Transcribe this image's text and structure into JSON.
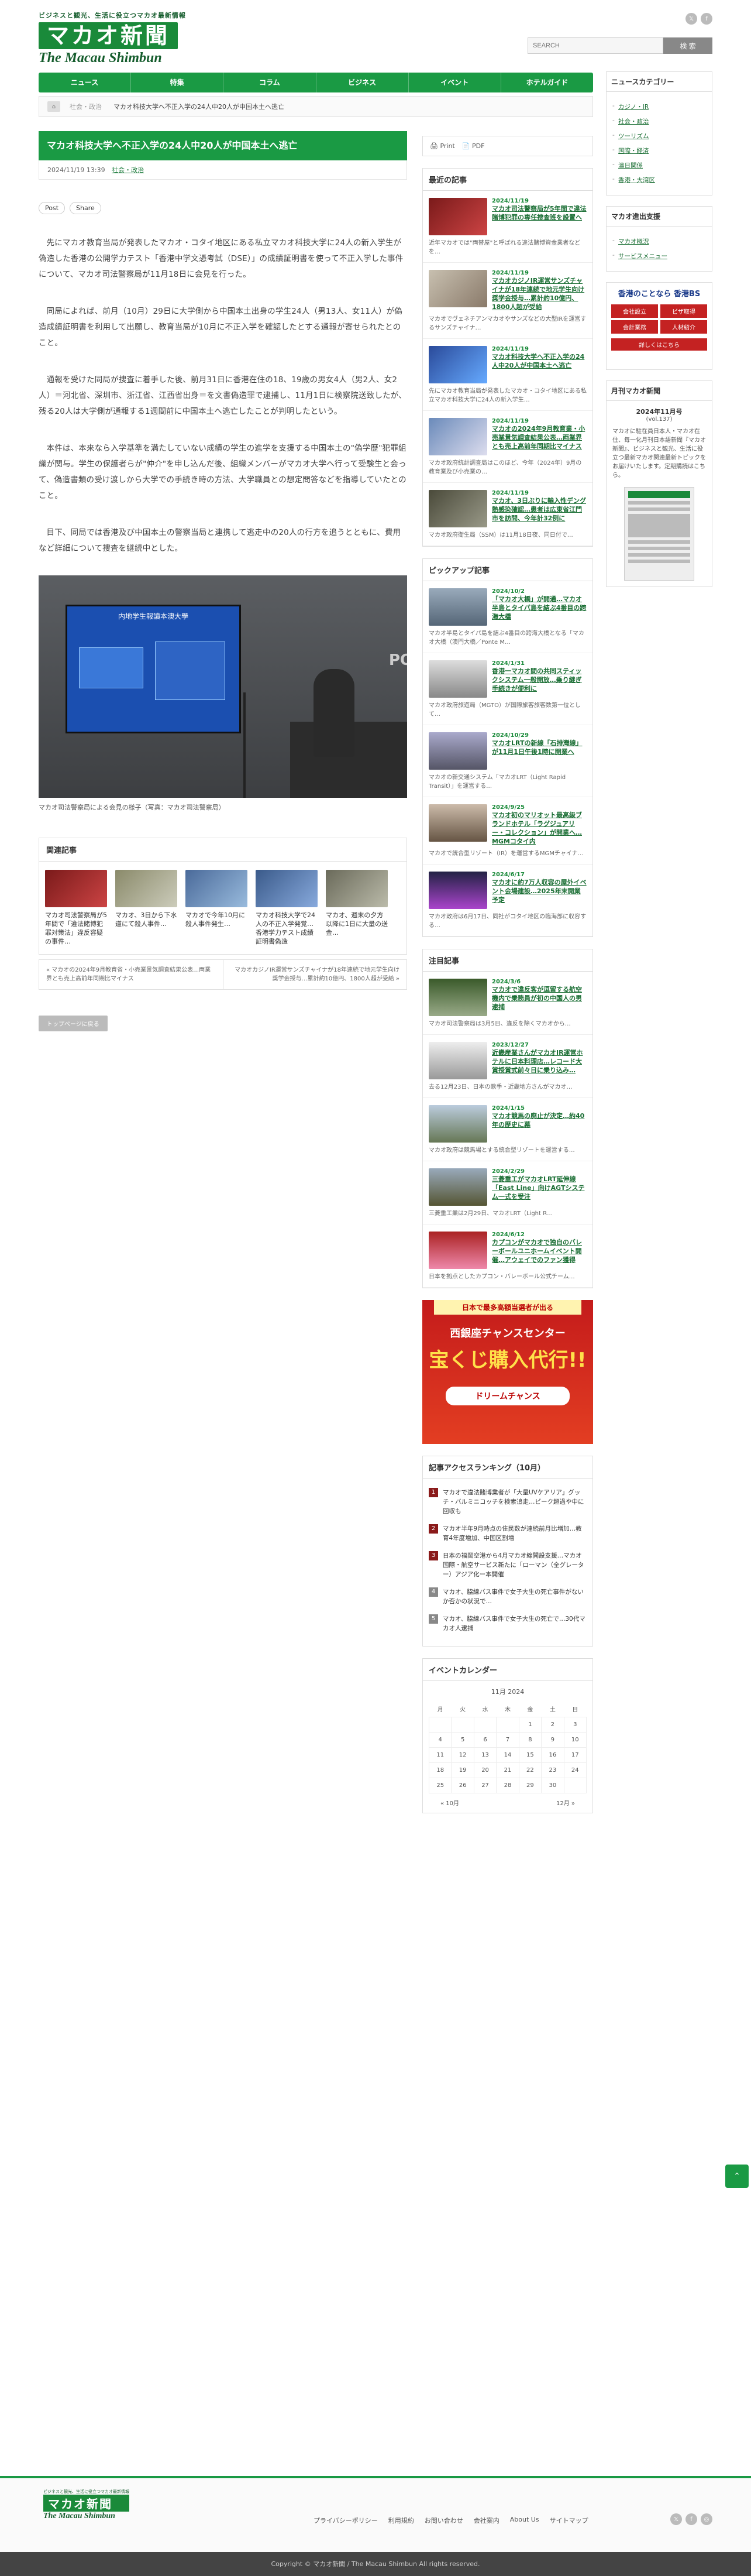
{
  "header": {
    "tagline": "ビジネスと観光、生活に役立つマカオ最新情報",
    "logo_jp": "マカオ新聞",
    "logo_en": "The Macau Shimbun",
    "search_placeholder": "SEARCH",
    "search_button": "検 索",
    "social": [
      "twitter-icon",
      "facebook-icon"
    ]
  },
  "nav": [
    "ニュース",
    "特集",
    "コラム",
    "ビジネス",
    "イベント",
    "ホテルガイド"
  ],
  "breadcrumb": {
    "items": [
      "社会・政治"
    ],
    "current": "マカオ科技大学へ不正入学の24人中20人が中国本土へ逃亡"
  },
  "article": {
    "title": "マカオ科技大学へ不正入学の24人中20人が中国本土へ逃亡",
    "date": "2024/11/19 13:39",
    "category": "社会・政治",
    "share": [
      "Post",
      "Share"
    ],
    "paragraphs": [
      "先にマカオ教育当局が発表したマカオ・コタイ地区にある私立マカオ科技大学に24人の新入学生が偽造した香港の公開学力テスト「香港中学文憑考試（DSE）」の成績証明書を使って不正入学した事件について、マカオ司法警察局が11月18日に会見を行った。",
      "同局によれば、前月（10月）29日に大学側から中国本土出身の学生24人（男13人、女11人）が偽造成績証明書を利用して出願し、教育当局が10月に不正入学を確認したとする通報が寄せられたとのこと。",
      "通報を受けた同局が捜査に着手した後、前月31日に香港在住の18、19歳の男女4人（男2人、女2人）＝河北省、深圳市、浙江省、江西省出身＝を文書偽造罪で逮捕し、11月1日に検察院送致したが、残る20人は大学側が通報する1週間前に中国本土へ逃亡したことが判明したという。",
      "本件は、本来なら入学基準を満たしていない成績の学生の進学を支援する中国本土の\"偽学歴\"犯罪組織が関与。学生の保護者らが\"仲介\"を申し込んだ後、組織メンバーがマカオ大学へ行って受験生と会って、偽造書類の受け渡しから大学での手続き時の方法、大学職員との想定問答などを指導していたとのこと。",
      "目下、同局では香港及び中国本土の警察当局と連携して逃走中の20人の行方を追うとともに、費用など詳細について捜査を継続中とした。"
    ],
    "photo_screen_title": "内地学生報讀本澳大學",
    "photo_sign": "PO",
    "caption": "マカオ司法警察局による会見の様子（写真：マカオ司法警察局）"
  },
  "related": {
    "title": "関連記事",
    "items": [
      "マカオ司法警察局が5年間で「違法賭博犯罪対策法」違反容疑の事件…",
      "マカオ、3日から下水道にて殺人事件…",
      "マカオで今年10月に殺人事件発生…",
      "マカオ科技大学で24人の不正入学発覚…香港学力テスト成績証明書偽造",
      "マカオ、週末の夕方以降に1日に大量の送金…"
    ]
  },
  "prev_next": {
    "prev": "« マカオの2024年9月教育省・小売業景気調査結果公表…両業界とも売上高前年同期比マイナス",
    "next": "マカオカジノIR運営サンズチャイナが18年連続で地元学生向け奨学金授与…累計約10億円、1800人超が受給 »"
  },
  "to_top": "トップページに戻る",
  "middle": {
    "print": "Print",
    "pdf": "PDF",
    "recent": {
      "title": "最近の記事",
      "items": [
        {
          "date": "2024/11/19",
          "title": "マカオ司法警察局が5年間で違法賭博犯罪の専任捜査班を設置へ",
          "excerpt": "近年マカオでは\"両替屋\"と呼ばれる違法賭博資金業者などを…"
        },
        {
          "date": "2024/11/19",
          "title": "マカオカジノIR運営サンズチャイナが18年連続で地元学生向け奨学金授与…累計約10億円、1800人超が受給",
          "excerpt": "マカオでヴェネチアンマカオやサンズなどの大型IRを運営するサンズチャイナ…"
        },
        {
          "date": "2024/11/19",
          "title": "マカオ科技大学へ不正入学の24人中20人が中国本土へ逃亡",
          "excerpt": "先にマカオ教育当局が発表したマカオ・コタイ地区にある私立マカオ科技大学に24人の新入学生…"
        },
        {
          "date": "2024/11/19",
          "title": "マカオの2024年9月教育業・小売業景気調査結果公表…両業界とも売上高前年同期比マイナス",
          "excerpt": "マカオ政府統計調査局はこのほど、今年（2024年）9月の教育業及び小売業の…"
        },
        {
          "date": "2024/11/19",
          "title": "マカオ、3日ぶりに輸入性デング熱感染確認…患者は広東省江門市を訪問、今年計32例に",
          "excerpt": "マカオ政府衛生局（SSM）は11月18日夜、同日付で…"
        }
      ]
    },
    "pickup": {
      "title": "ピックアップ記事",
      "items": [
        {
          "date": "2024/10/2",
          "title": "「マカオ大橋」が開通…マカオ半島とタイパ島を結ぶ4番目の跨海大橋",
          "excerpt": "マカオ半島とタイパ島を結ぶ4番目の跨海大橋となる「マカオ大橋（澳門大橋／Ponte M…"
        },
        {
          "date": "2024/1/31",
          "title": "香港一マカオ間の共同スティックシステム一般開放…乗り継ぎ手続きが便利に",
          "excerpt": "マカオ政府旅遊局（MGTO）が国際旅客旅客数第一位として…"
        },
        {
          "date": "2024/10/29",
          "title": "マカオLRTの新線「石排灣線」が11月1日午後1時に開業へ",
          "excerpt": "マカオの新交通システム「マカオLRT（Light Rapid Transit）」を運営する…"
        },
        {
          "date": "2024/9/25",
          "title": "マカオ初のマリオット最高級ブランドホテル「ラグジュアリー・コレクション」が開業へ…MGMコタイ内",
          "excerpt": "マカオで統合型リゾート（IR）を運営するMGMチャイナ…"
        },
        {
          "date": "2024/6/17",
          "title": "マカオに約7万人収容の屋外イベント会場建設…2025年末開業予定",
          "excerpt": "マカオ政府は6月17日、同社がコタイ地区の臨海部に収容する…"
        }
      ]
    },
    "noteworthy": {
      "title": "注目記事",
      "items": [
        {
          "date": "2024/3/6",
          "title": "マカオで違反客が逗留する航空機内で乗務員が初の中国人の男逮捕",
          "excerpt": "マカオ司法警察局は3月5日、違反を除くマカオから…"
        },
        {
          "date": "2023/12/27",
          "title": "近畿産業さんがマカオIR運営ホテルに日本料理店…レコード大賞授賞式前々日に乗り込み…",
          "excerpt": "去る12月23日、日本の歌手・近畿地方さんがマカオ…"
        },
        {
          "date": "2024/1/15",
          "title": "マカオ競馬の廃止が決定…約40年の歴史に幕",
          "excerpt": "マカオ政府は競馬場とする統合型リゾートを運営する…"
        },
        {
          "date": "2024/2/29",
          "title": "三菱重工がマカオLRT延伸線「East Line」向けAGTシステム一式を受注",
          "excerpt": "三菱重工業は2月29日、マカオLRT（Light R…"
        },
        {
          "date": "2024/6/12",
          "title": "カプコンがマカオで独自のバレーボールユニホームイベント開催…アウェイでのファン獲得",
          "excerpt": "日本を拠点としたカプコン・バレーボール公式チーム…"
        }
      ]
    },
    "ad": {
      "line1": "日本で最多高額当選者が出る",
      "line2": "西銀座チャンスセンター",
      "line3": "宝くじ購入代行!!",
      "line4": "ドリームチャンス"
    },
    "ranking": {
      "title": "記事アクセスランキング（10月）",
      "items": [
        "マカオで違法賭博業者が「大量UVケアリア」グッチ・バルミニコッチを検索追走…ピーク超過や中に回収も",
        "マカオ半年9月時点の住民数が連続前月比増加…教育4年度増加、中国区割増",
        "日本の福岡空港から4月マカオ線開設支援…マカオ国際・航空サービス新たに「ローマン（全グレーター）アジア化ー本開催",
        "マカオ、脇線バス事件で女子大生の死亡事件がないか否かの状況で…",
        "マカオ、脇線バス事件で女子大生の死亡で…30代マカオ人逮捕"
      ]
    },
    "calendar": {
      "title": "イベントカレンダー",
      "month": "11月 2024",
      "days": [
        "月",
        "火",
        "水",
        "木",
        "金",
        "土",
        "日"
      ],
      "weeks": [
        [
          "",
          "",
          "",
          "",
          "1",
          "2",
          "3"
        ],
        [
          "4",
          "5",
          "6",
          "7",
          "8",
          "9",
          "10"
        ],
        [
          "11",
          "12",
          "13",
          "14",
          "15",
          "16",
          "17"
        ],
        [
          "18",
          "19",
          "20",
          "21",
          "22",
          "23",
          "24"
        ],
        [
          "25",
          "26",
          "27",
          "28",
          "29",
          "30",
          ""
        ]
      ],
      "prev": "« 10月",
      "next": "12月 »"
    }
  },
  "right": {
    "categories": {
      "title": "ニュースカテゴリー",
      "items": [
        "カジノ・IR",
        "社会・政治",
        "ツーリズム",
        "国際・経済",
        "澳日関係",
        "香港・大湾区"
      ]
    },
    "support": {
      "title": "マカオ進出支援",
      "items": [
        "マカオ概況",
        "サービスメニュー"
      ]
    },
    "bs_ad": {
      "title": "香港のことなら 香港BS",
      "items": [
        "会社設立",
        "ビザ取得",
        "会計業務",
        "人材紹介"
      ],
      "cta": "詳しくはこちら"
    },
    "monthly": {
      "title": "月刊マカオ新聞",
      "month": "2024年11月号",
      "vol": "(vol.137)",
      "text": "マカオに駐在員日本人・マカオ在住、毎一化月刊日本語新聞『マカオ新聞』、ビジネスと観光、生活に役立つ最新マカオ関連最新トピックをお届けいたします。定期購読はこちら。"
    }
  },
  "footer": {
    "tagline": "ビジネスと観光、生活に役立つマカオ最新情報",
    "logo_jp": "マカオ新聞",
    "logo_en": "The Macau Shimbun",
    "links": [
      "プライバシーポリシー",
      "利用規約",
      "お問い合わせ",
      "会社案内",
      "About Us",
      "サイトマップ"
    ],
    "copyright": "Copyright © マカオ新聞 / The Macau Shimbun All rights reserved."
  },
  "colors": {
    "accent": "#1a9a44",
    "dark_green": "#145c2c",
    "rank": "#8a1a1a"
  }
}
